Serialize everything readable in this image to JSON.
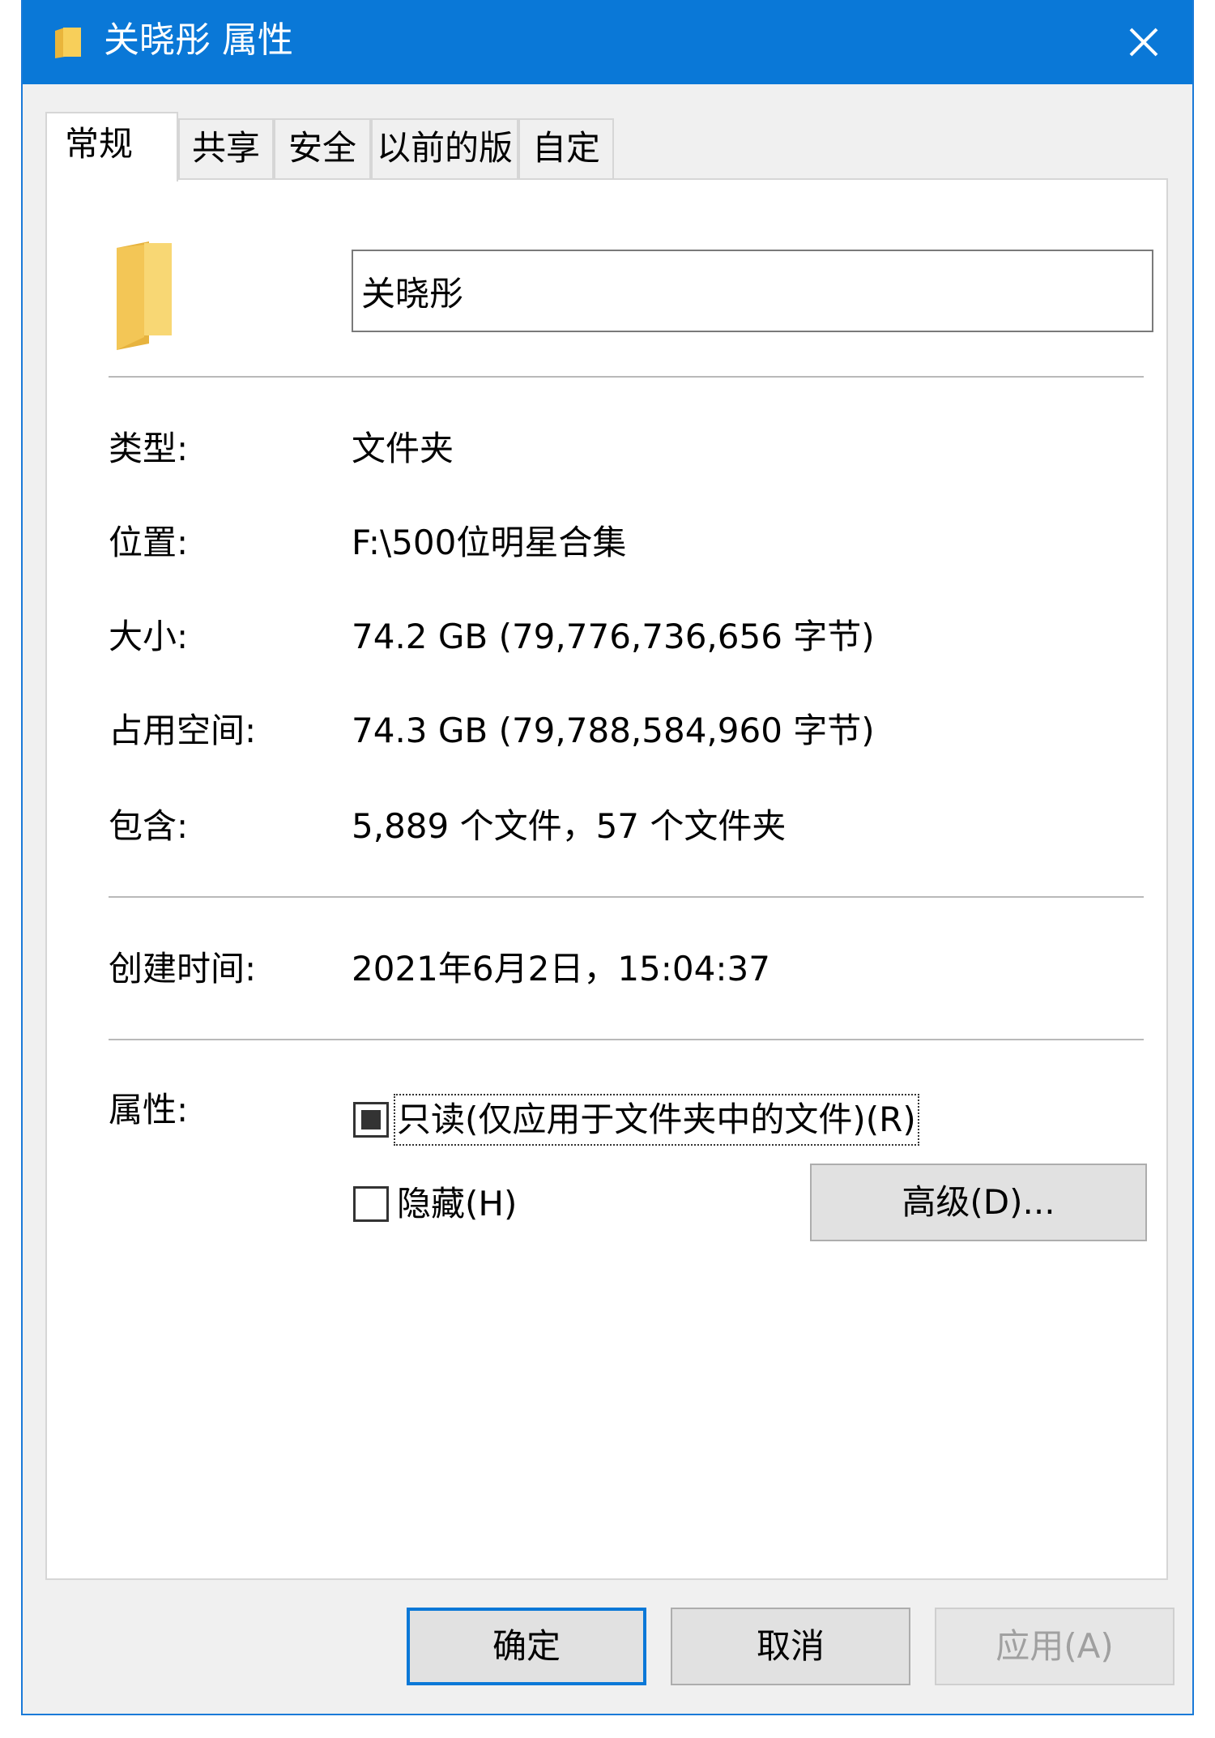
{
  "window": {
    "title": "关晓彤 属性",
    "close_label": "✕"
  },
  "tabs": [
    {
      "label": "常规",
      "active": true
    },
    {
      "label": "共享",
      "active": false
    },
    {
      "label": "安全",
      "active": false
    },
    {
      "label": "以前的版本",
      "active": false
    },
    {
      "label": "自定义",
      "active": false
    }
  ],
  "general": {
    "name_value": "关晓彤",
    "type_label": "类型:",
    "type_value": "文件夹",
    "location_label": "位置:",
    "location_value": "F:\\500位明星合集",
    "size_label": "大小:",
    "size_value": "74.2 GB (79,776,736,656 字节)",
    "size_on_disk_label": "占用空间:",
    "size_on_disk_value": "74.3 GB (79,788,584,960 字节)",
    "contains_label": "包含:",
    "contains_value": "5,889 个文件，57 个文件夹",
    "created_label": "创建时间:",
    "created_value": "2021年6月2日，15:04:37",
    "attributes_label": "属性:",
    "readonly_label": "只读(仅应用于文件夹中的文件)(R)",
    "readonly_state": "indeterminate",
    "hidden_label": "隐藏(H)",
    "hidden_state": "unchecked",
    "advanced_label": "高级(D)..."
  },
  "footer": {
    "ok_label": "确定",
    "cancel_label": "取消",
    "apply_label": "应用(A)"
  },
  "colors": {
    "titlebar": "#0a78d7",
    "accent": "#0a78d7",
    "folder": "#f5c84a"
  }
}
